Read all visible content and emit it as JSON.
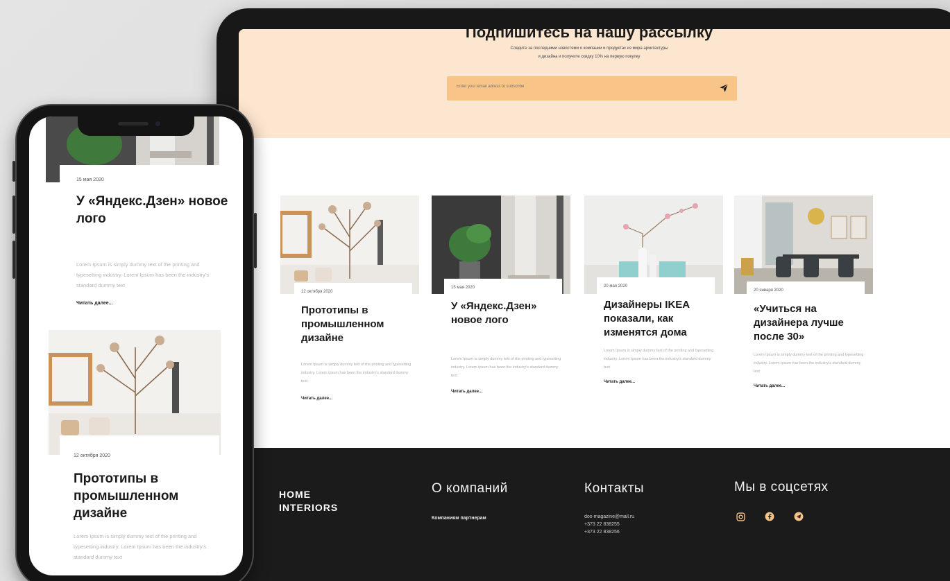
{
  "newsletter": {
    "title": "Подпишитесь на нашу рассылку",
    "subtitle_line1": "Следите за последними новостями о компании и продуктах из мира архитектуры",
    "subtitle_line2": "и дизайна и получите скидку 10% на первую покупку",
    "email_placeholder": "Enter your email adress to subscribe",
    "send_icon": "paper-plane-icon",
    "colors": {
      "band": "#fde6cf",
      "form": "#f8c487"
    }
  },
  "posts": [
    {
      "date": "12 октября 2020",
      "title": "Прототипы в промышленном дизайне",
      "text": "Lorem Ipsum is simply dummy text of the printing and typesetting industry. Lorem Ipsum has been the industry's standard dummy text",
      "more": "Читать далее..."
    },
    {
      "date": "15 мая 2020",
      "title": "У «Яндекс.Дзен» новое лого",
      "text": "Lorem Ipsum is simply dummy text of the printing and typesetting industry. Lorem Ipsum has been the industry's standard dummy text",
      "more": "Читать далее..."
    },
    {
      "date": "20 мая 2020",
      "title": "Дизайнеры IKEA показали, как изменятся дома",
      "text": "Lorem Ipsum is simply dummy text of the printing and typesetting industry. Lorem Ipsum has been the industry's standard dummy text",
      "more": "Читать далее..."
    },
    {
      "date": "20 января 2020",
      "title": "«Учиться на дизайнера лучше после 30»",
      "text": "Lorem Ipsum is simply dummy text of the printing and typesetting industry. Lorem Ipsum has been the industry's standard dummy text",
      "more": "Читать далее..."
    }
  ],
  "footer": {
    "brand": "HOME INTERIORS",
    "about": {
      "heading": "О компаний",
      "link": "Компаниям партнерам"
    },
    "contacts": {
      "heading": "Контакты",
      "email": "dos-magazine@mail.ru",
      "phone1": "+373 22 838255",
      "phone2": "+373 22 838256"
    },
    "social": {
      "heading": "Мы в соцсетях",
      "icons": [
        "instagram-icon",
        "facebook-icon",
        "telegram-icon"
      ],
      "icon_color": "#f8c487"
    }
  },
  "mobile": {
    "posts": [
      {
        "date": "15 мая 2020",
        "title": "У «Яндекс.Дзен» новое лого",
        "text": "Lorem Ipsum is simply dummy text of the printing and typesetting industry. Lorem Ipsum has been the industry's standard dummy text",
        "more": "Читать далее..."
      },
      {
        "date": "12 октября 2020",
        "title": "Прототипы в промышленном дизайне",
        "text": "Lorem Ipsum is simply dummy text of the printing and typesetting industry. Lorem Ipsum has been the industry's standard dummy text"
      }
    ]
  }
}
